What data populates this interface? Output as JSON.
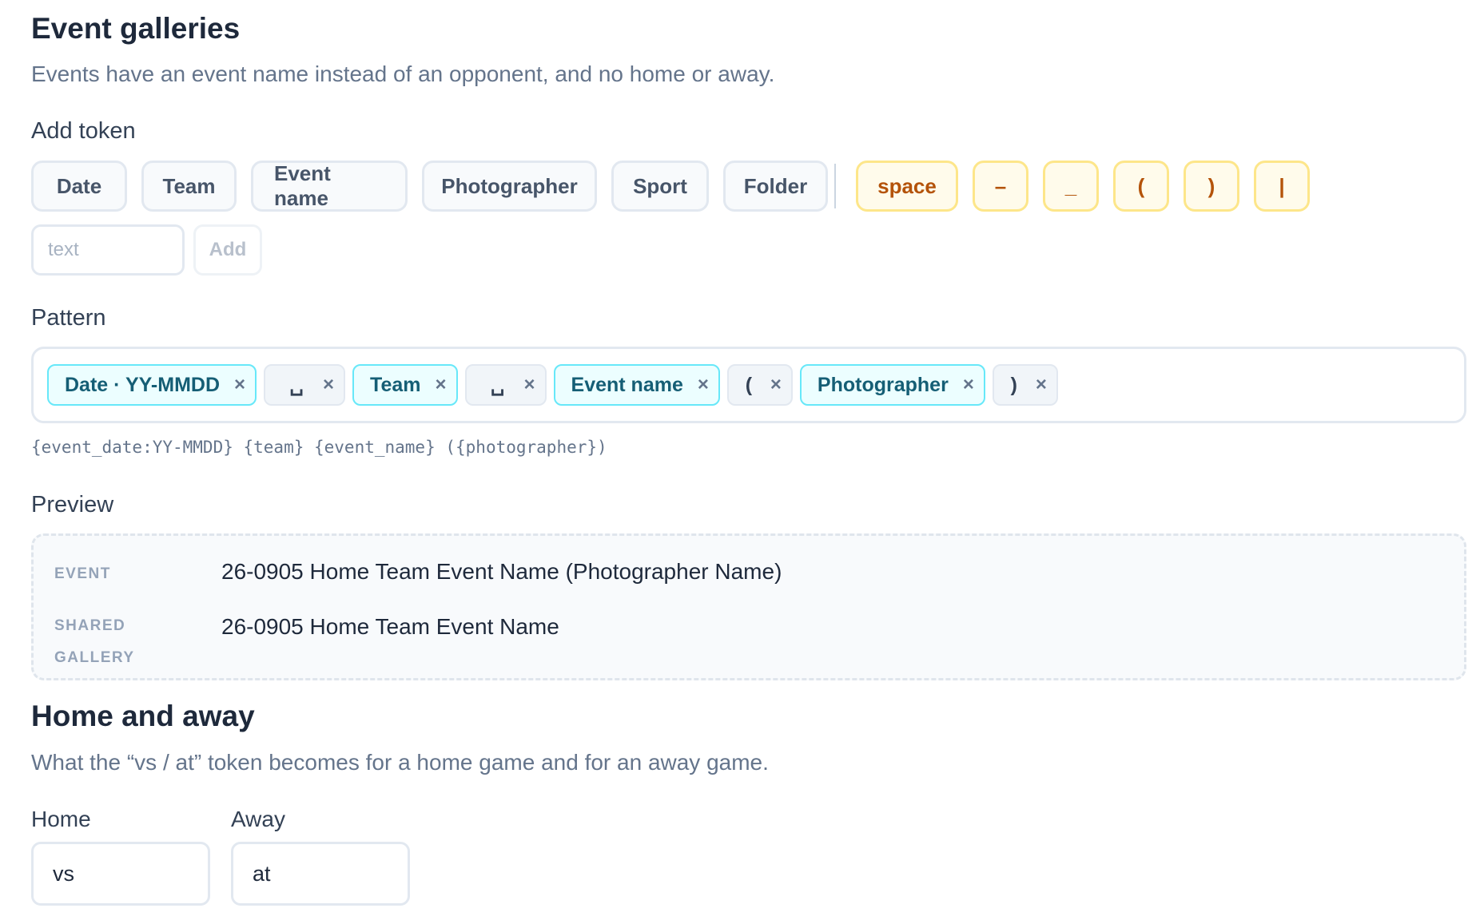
{
  "event_galleries": {
    "title": "Event galleries",
    "description": "Events have an event name instead of an opponent, and no home or away."
  },
  "add_token": {
    "label": "Add token",
    "tokens": [
      "Date",
      "Team",
      "Event name",
      "Photographer",
      "Sport",
      "Folder"
    ],
    "symbols": [
      "space",
      "–",
      "_",
      "(",
      ")",
      "|"
    ],
    "custom_text": {
      "placeholder": "text",
      "value": ""
    },
    "add_button": "Add"
  },
  "pattern": {
    "label": "Pattern",
    "chips": [
      {
        "label": "Date · YY-MMDD",
        "kind": "field"
      },
      {
        "label": "␣",
        "kind": "literal"
      },
      {
        "label": "Team",
        "kind": "field"
      },
      {
        "label": "␣",
        "kind": "literal"
      },
      {
        "label": "Event name",
        "kind": "field"
      },
      {
        "label": "(",
        "kind": "literal"
      },
      {
        "label": "Photographer",
        "kind": "field"
      },
      {
        "label": ")",
        "kind": "literal"
      }
    ],
    "remove_glyph": "×",
    "template_string": "{event_date:YY-MMDD} {team} {event_name} ({photographer})"
  },
  "preview": {
    "label": "Preview",
    "rows": [
      {
        "key": "EVENT",
        "value": "26-0905 Home Team Event Name (Photographer Name)"
      },
      {
        "key": "SHARED GALLERY",
        "value": "26-0905 Home Team Event Name"
      }
    ]
  },
  "home_away": {
    "title": "Home and away",
    "description": "What the “vs / at” token becomes for a home game and for an away game.",
    "home_label": "Home",
    "home_value": "vs",
    "away_label": "Away",
    "away_value": "at"
  }
}
